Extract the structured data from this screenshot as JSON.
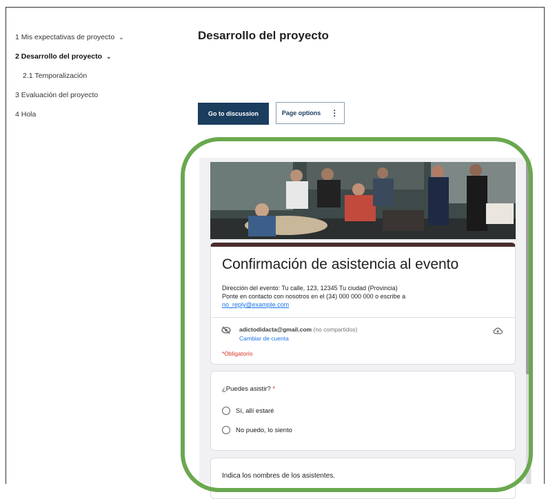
{
  "toc": {
    "items": [
      {
        "label": "1 Mis expectativas de proyecto",
        "chevron": "chevron-down-icon"
      },
      {
        "label": "2 Desarrollo del proyecto",
        "chevron": "chevron-down-icon"
      },
      {
        "label": "2.1 Temporalización"
      },
      {
        "label": "3 Evaluación del proyecto"
      },
      {
        "label": "4 Hola"
      }
    ]
  },
  "page": {
    "title": "Desarrollo del proyecto",
    "discussion_label": "Go to discussion",
    "options_label": "Page options"
  },
  "form": {
    "title": "Confirmación de asistencia al evento",
    "desc_line1": "Dirección del evento: Tu calle, 123, 12345 Tu ciudad (Provincia)",
    "desc_line2": "Ponte en contacto con nosotros en el (34) 000 000 000 o escribe a",
    "desc_link": "no_reply@example.com",
    "account_email": "adictodidacta@gmail.com",
    "account_note": "(no compartidos)",
    "switch_account": "Cambiar de cuenta",
    "required_note": "*Obligatorio",
    "q1": {
      "label": "¿Puedes asistir?",
      "required_mark": "*",
      "options": [
        "Sí, allí estaré",
        "No puedo, lo siento"
      ]
    },
    "q2": {
      "label": "Indica los nombres de los asistentes."
    }
  },
  "colors": {
    "primary_button": "#1b3d5e",
    "highlight_ring": "#6aa84f",
    "form_accent": "#4a2c2c",
    "required": "#d93025",
    "link": "#1a73e8"
  }
}
